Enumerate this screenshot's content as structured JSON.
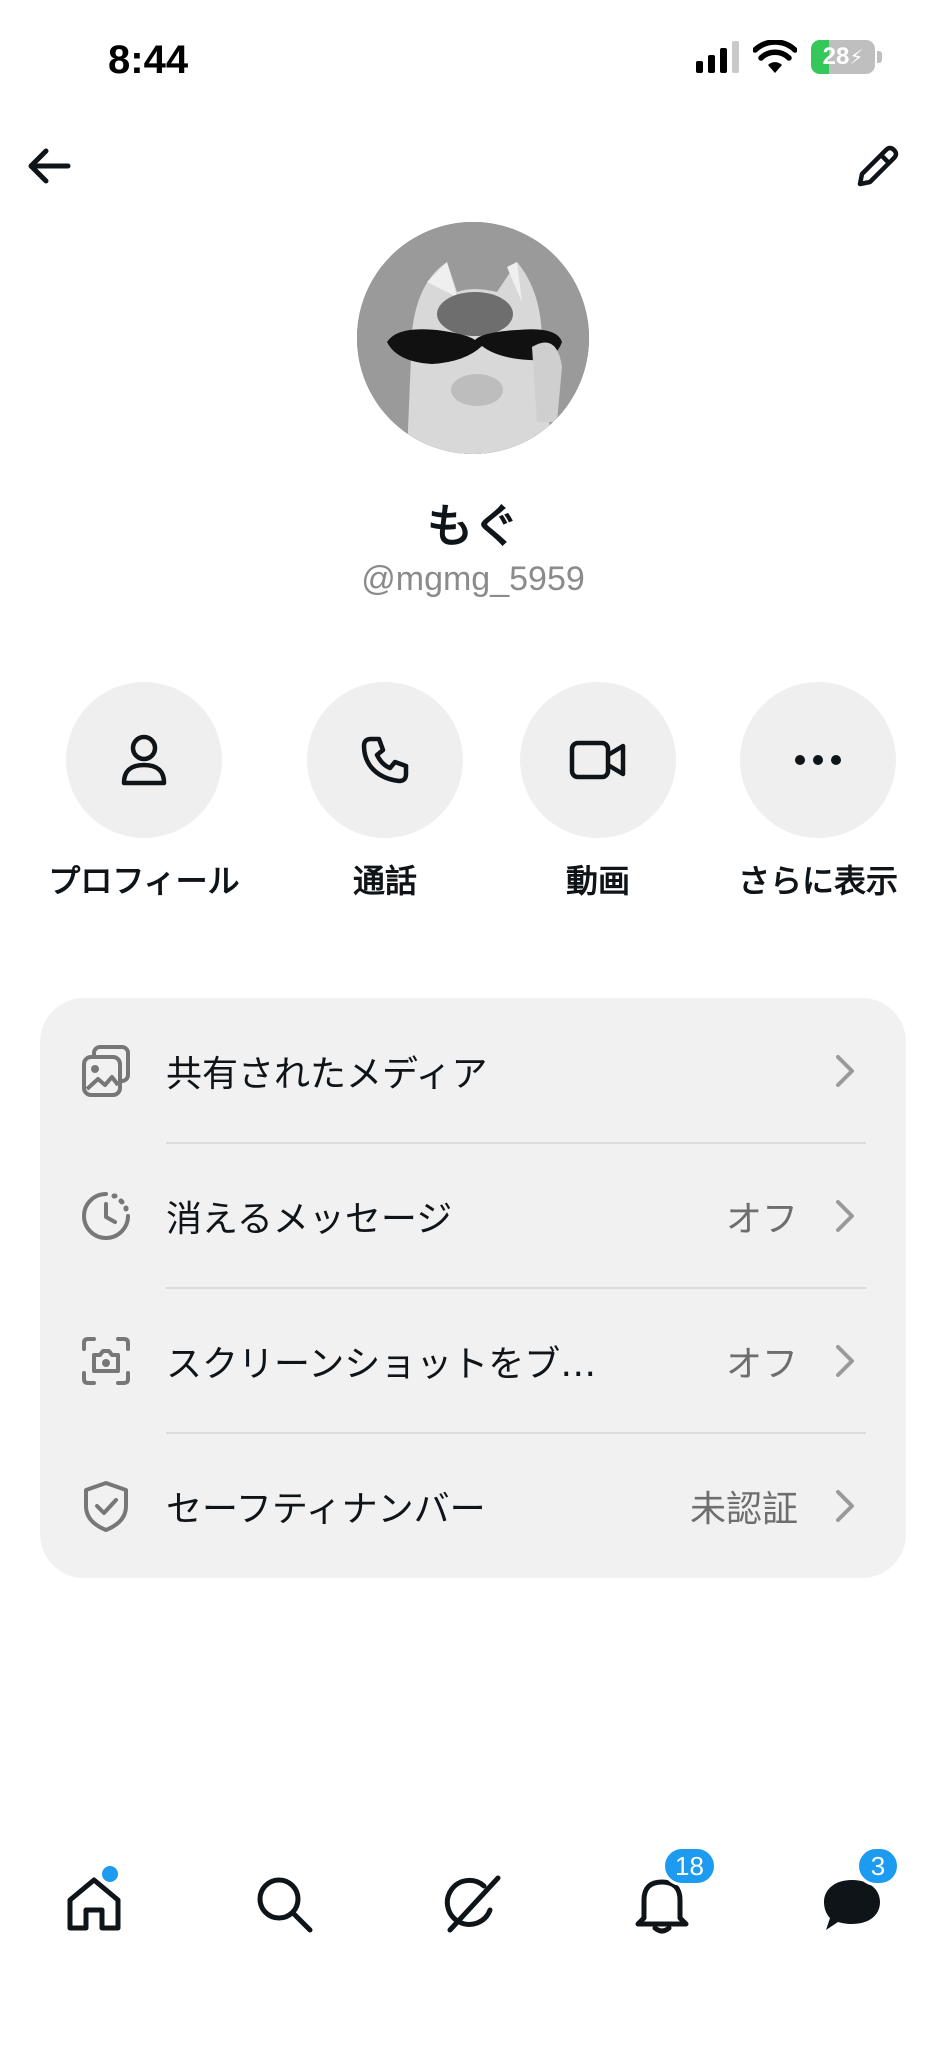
{
  "status_bar": {
    "time": "8:44",
    "battery": "28"
  },
  "header": {
    "back": "back",
    "edit": "edit"
  },
  "profile": {
    "name": "もぐ",
    "handle": "@mgmg_5959"
  },
  "actions": [
    {
      "label": "プロフィール",
      "icon": "person-icon"
    },
    {
      "label": "通話",
      "icon": "phone-icon"
    },
    {
      "label": "動画",
      "icon": "video-icon"
    },
    {
      "label": "さらに表示",
      "icon": "more-icon"
    }
  ],
  "settings": [
    {
      "title": "共有されたメディア",
      "value": "",
      "icon": "media-icon"
    },
    {
      "title": "消えるメッセージ",
      "value": "オフ",
      "icon": "timer-icon"
    },
    {
      "title": "スクリーンショットをブ…",
      "value": "オフ",
      "icon": "screenshot-icon"
    },
    {
      "title": "セーフティナンバー",
      "value": "未認証",
      "icon": "shield-icon"
    }
  ],
  "bottom_nav": {
    "notifications_badge": "18",
    "messages_badge": "3"
  },
  "colors": {
    "accent": "#1d9bf0",
    "card_bg": "#f1f1f1",
    "secondary_text": "#8b8b8b"
  }
}
